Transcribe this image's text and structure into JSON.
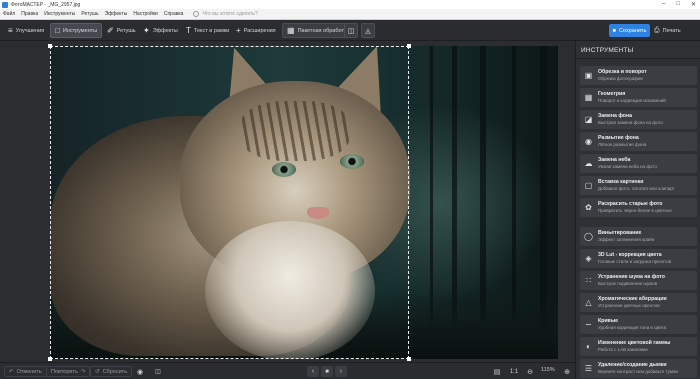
{
  "window": {
    "title": "ФотоМАСТЕР - _MG_2957.jpg"
  },
  "menu": {
    "items": [
      "Файл",
      "Правка",
      "Инструменты",
      "Ретушь",
      "Эффекты",
      "Настройки",
      "Справка"
    ],
    "search_placeholder": "Что вы хотите сделать?"
  },
  "toolbar": {
    "tabs": [
      {
        "label": "Улучшения",
        "icon": "sliders-icon"
      },
      {
        "label": "Инструменты",
        "icon": "crop-icon",
        "active": true
      },
      {
        "label": "Ретушь",
        "icon": "brush-icon"
      },
      {
        "label": "Эффекты",
        "icon": "sparkle-icon"
      },
      {
        "label": "Текст и рамки",
        "icon": "text-icon"
      },
      {
        "label": "Расширения",
        "icon": "plus-icon"
      },
      {
        "label": "Пакетная обработка",
        "icon": "batch-icon"
      }
    ],
    "save_label": "Сохранить",
    "print_label": "Печать"
  },
  "panel": {
    "title": "ИНСТРУМЕНТЫ",
    "tools": [
      {
        "title": "Обрезка и поворот",
        "desc": "Обрезка фотографии",
        "icon": "crop-icon"
      },
      {
        "title": "Геометрия",
        "desc": "Поворот и коррекция искажений",
        "icon": "grid-icon"
      },
      {
        "title": "Замена фона",
        "desc": "Быстрая замена фона на фото",
        "icon": "layers-icon"
      },
      {
        "title": "Размытие фона",
        "desc": "Лёгкое размытие фона",
        "icon": "blur-icon"
      },
      {
        "title": "Замена неба",
        "desc": "Умная замена неба на фото",
        "icon": "cloud-icon"
      },
      {
        "title": "Вставка картинки",
        "desc": "Добавьте фото, логотип или клипарт",
        "icon": "image-icon"
      },
      {
        "title": "Раскрасить старые фото",
        "desc": "Превратить чёрно-белое в цветное",
        "icon": "palette-icon"
      },
      {
        "title": "Виньетирование",
        "desc": "Эффект затемнения краёв",
        "icon": "vignette-icon"
      },
      {
        "title": "3D Lut - коррекция цвета",
        "desc": "Готовые стили и загрузка пресетов",
        "icon": "lut-icon"
      },
      {
        "title": "Устранение шума на фото",
        "desc": "Быстрое подавление шумов",
        "icon": "noise-icon"
      },
      {
        "title": "Хроматические аберрации",
        "desc": "Устранение цветных ореолов",
        "icon": "prism-icon"
      },
      {
        "title": "Кривые",
        "desc": "Удобная коррекция тона и цвета",
        "icon": "curves-icon"
      },
      {
        "title": "Изменение цветовой гаммы",
        "desc": "Работа с LAB каналами",
        "icon": "hue-icon"
      },
      {
        "title": "Удаление/создание дымки",
        "desc": "Верните контраст или добавьте туман",
        "icon": "haze-icon"
      }
    ]
  },
  "bottombar": {
    "undo_label": "Отменить",
    "redo_label": "Повторить",
    "reset_label": "Сбросить",
    "ratio_label": "1:1",
    "zoom_value": "115%"
  },
  "colors": {
    "accent": "#2f82e0",
    "panel": "#2e3034",
    "toolbar": "#2a2c30"
  }
}
